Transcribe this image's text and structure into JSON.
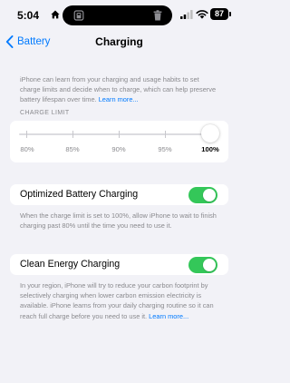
{
  "status_bar": {
    "time": "5:04",
    "battery_level": "87",
    "icons": [
      "home-icon",
      "lock-icon",
      "trash-icon",
      "cellular-signal-icon",
      "wifi-icon",
      "battery-icon"
    ]
  },
  "nav": {
    "back_label": "Battery",
    "title": "Charging"
  },
  "intro": {
    "text": "iPhone can learn from your charging and usage habits to set charge limits and decide when to charge, which can help preserve battery lifespan over time.",
    "link": "Learn more..."
  },
  "charge_limit": {
    "header": "CHARGE LIMIT",
    "options": [
      "80%",
      "85%",
      "90%",
      "95%",
      "100%"
    ],
    "selected": "100%",
    "selected_index": 4
  },
  "optimized": {
    "label": "Optimized Battery Charging",
    "enabled": true,
    "footnote": "When the charge limit is set to 100%, allow iPhone to wait to finish charging past 80% until the time you need to use it."
  },
  "clean_energy": {
    "label": "Clean Energy Charging",
    "enabled": true,
    "footnote": "In your region, iPhone will try to reduce your carbon footprint by selectively charging when lower carbon emission electricity is available. iPhone learns from your daily charging routine so it can reach full charge before you need to use it.",
    "link": "Learn more..."
  },
  "colors": {
    "accent": "#007aff",
    "toggle_on": "#34c759",
    "background": "#f2f2f7"
  }
}
